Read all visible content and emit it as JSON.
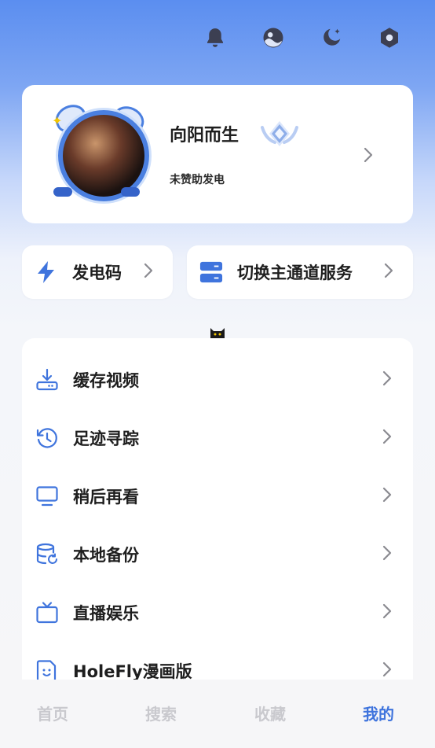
{
  "header": {
    "icons": [
      "bell-icon",
      "theme-icon",
      "night-mode-icon",
      "settings-icon"
    ]
  },
  "profile": {
    "username": "向阳而生",
    "sponsor_status": "未赞助发电"
  },
  "quick_actions": [
    {
      "label": "发电码",
      "icon": "lightning-icon"
    },
    {
      "label": "切换主通道服务",
      "icon": "server-icon"
    }
  ],
  "menu": {
    "items": [
      {
        "label": "缓存视频",
        "icon": "download-icon"
      },
      {
        "label": "足迹寻踪",
        "icon": "history-icon"
      },
      {
        "label": "稍后再看",
        "icon": "monitor-icon"
      },
      {
        "label": "本地备份",
        "icon": "database-backup-icon"
      },
      {
        "label": "直播娱乐",
        "icon": "tv-icon"
      },
      {
        "label": "HoleFly漫画版",
        "icon": "comic-icon"
      }
    ]
  },
  "tabs": [
    {
      "label": "首页",
      "active": false
    },
    {
      "label": "搜索",
      "active": false
    },
    {
      "label": "收藏",
      "active": false
    },
    {
      "label": "我的",
      "active": true
    }
  ],
  "colors": {
    "accent": "#3f74dd",
    "icon": "#4a7fe0",
    "inactive_tab": "#c9c9ce"
  }
}
